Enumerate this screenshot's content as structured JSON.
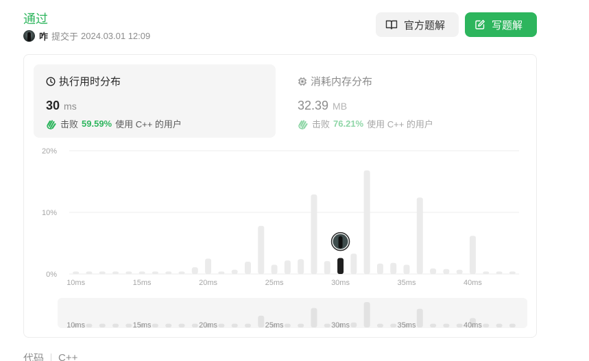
{
  "status": {
    "label": "通过"
  },
  "submission": {
    "user": "咋",
    "prefix": "提交于",
    "timestamp": "2024.03.01 12:09"
  },
  "buttons": {
    "official_solution": "官方题解",
    "write_solution": "写题解"
  },
  "colors": {
    "accent": "#2db55d",
    "bar": "#ebebeb",
    "bar_selected": "#1f1f1f"
  },
  "runtime": {
    "title": "执行用时分布",
    "value": "30",
    "unit": "ms",
    "beat_prefix": "击败",
    "beat_pct": "59.59%",
    "beat_suffix": "使用 C++ 的用户"
  },
  "memory": {
    "title": "消耗内存分布",
    "value": "32.39",
    "unit": "MB",
    "beat_prefix": "击败",
    "beat_pct": "76.21%",
    "beat_suffix": "使用 C++ 的用户"
  },
  "chart_data": [
    {
      "type": "bar",
      "yticks": [
        "20%",
        "10%",
        "0%"
      ],
      "ylim": [
        0,
        20
      ],
      "grid": true,
      "xticks": [
        "10ms",
        "15ms",
        "20ms",
        "25ms",
        "30ms",
        "35ms",
        "40ms"
      ],
      "x": [
        10,
        11,
        12,
        13,
        14,
        15,
        16,
        17,
        18,
        19,
        20,
        21,
        22,
        23,
        24,
        25,
        26,
        27,
        28,
        29,
        30,
        31,
        32,
        33,
        34,
        35,
        36,
        37,
        38,
        39,
        40,
        41,
        42,
        43
      ],
      "values": [
        0.4,
        0.4,
        0.4,
        0.4,
        0.4,
        0.4,
        0.4,
        0.4,
        0.4,
        1.1,
        2.5,
        0.4,
        0.7,
        2.0,
        7.8,
        1.5,
        2.2,
        2.4,
        12.9,
        2.1,
        2.6,
        3.3,
        16.8,
        1.7,
        1.8,
        1.5,
        12.4,
        0.9,
        0.8,
        0.7,
        6.2,
        0.4,
        0.4,
        0.4
      ],
      "selected_x": 30
    },
    {
      "type": "bar",
      "xticks": [
        "10ms",
        "15ms",
        "20ms",
        "25ms",
        "30ms",
        "35ms",
        "40ms"
      ],
      "x": [
        10,
        11,
        12,
        13,
        14,
        15,
        16,
        17,
        18,
        19,
        20,
        21,
        22,
        23,
        24,
        25,
        26,
        27,
        28,
        29,
        30,
        31,
        32,
        33,
        34,
        35,
        36,
        37,
        38,
        39,
        40,
        41,
        42,
        43
      ],
      "values": [
        0.4,
        0.4,
        0.4,
        0.4,
        0.4,
        0.4,
        0.4,
        0.4,
        0.4,
        1.1,
        2.5,
        0.4,
        0.7,
        2.0,
        7.8,
        1.5,
        2.2,
        2.4,
        12.9,
        2.1,
        2.6,
        3.3,
        16.8,
        1.7,
        1.8,
        1.5,
        12.4,
        0.9,
        0.8,
        0.7,
        6.2,
        0.4,
        0.4,
        0.4
      ]
    }
  ],
  "code_tab": {
    "label": "代码",
    "language": "C++"
  }
}
